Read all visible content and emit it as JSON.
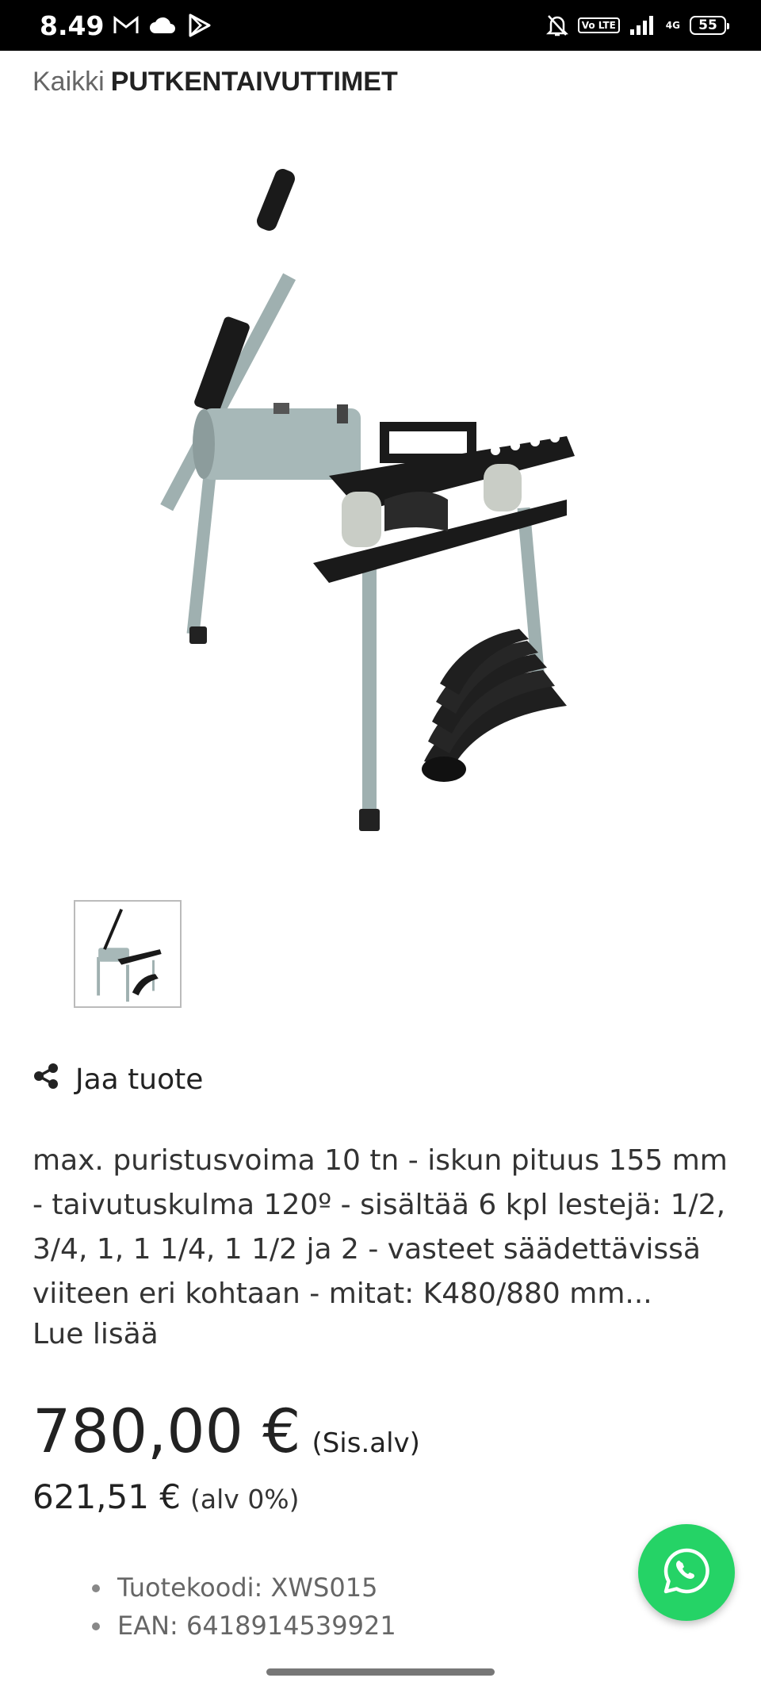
{
  "status_bar": {
    "time": "8.49",
    "network": "4G",
    "battery": "55",
    "volte": "Vo LTE"
  },
  "breadcrumb": {
    "home": "Kaikki",
    "category": "PUTKENTAIVUTTIMET"
  },
  "product": {
    "image_icon": "hydraulic-pipe-bender-image",
    "share_label": "Jaa tuote",
    "description": "max. puristusvoima 10 tn - iskun pituus 155 mm - taivutuskulma 120º - sisältää 6 kpl lestejä: 1/2, 3/4, 1, 1 1/4, 1 1/2 ja 2 - vasteet säädettävissä viiteen eri kohtaan - mitat: K480/880 mm...",
    "read_more": "Lue lisää",
    "price": "780,00 €",
    "price_note": "(Sis.alv)",
    "price_excl": "621,51 €",
    "price_excl_note": "(alv 0%)",
    "meta": [
      {
        "label": "Tuotekoodi: XWS015"
      },
      {
        "label": "EAN: 6418914539921"
      }
    ]
  },
  "colors": {
    "whatsapp_green": "#25d366",
    "bender_body": "#a7b8b8",
    "bender_plate": "#1a1a1a"
  },
  "icons": {
    "share": "share-icon",
    "whatsapp": "whatsapp-icon"
  }
}
